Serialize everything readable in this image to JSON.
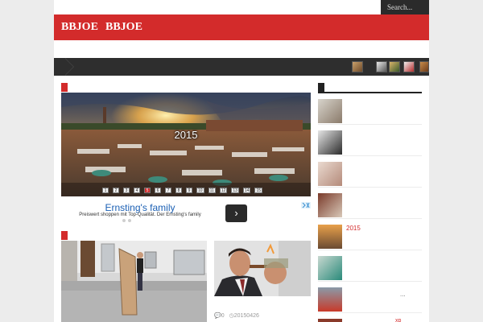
{
  "search": {
    "placeholder": "Search..."
  },
  "nav": {
    "items": [
      {
        "label": "BBJOE"
      },
      {
        "label": "BBJOE"
      }
    ]
  },
  "slider": {
    "title": "2015",
    "pages": [
      "1",
      "2",
      "3",
      "4",
      "5",
      "6",
      "7",
      "8",
      "9",
      "10",
      "11",
      "12",
      "13",
      "14",
      "15"
    ],
    "active_page": "5"
  },
  "ad": {
    "title": "Ernsting's family",
    "text": "Preiswert shoppen mit Top-Qualität. Der Ernsting's family",
    "arrow": "›"
  },
  "post_meta": {
    "comments": "0",
    "date": "20150426"
  },
  "sidebar": {
    "items": [
      {
        "label": ""
      },
      {
        "label": ""
      },
      {
        "label": ""
      },
      {
        "label": ""
      },
      {
        "label": "2015"
      },
      {
        "label": ""
      },
      {
        "label": "..."
      },
      {
        "label": "xp"
      }
    ]
  },
  "colors": {
    "brand_red": "#d32b2b",
    "dark_bar": "#2e2e2e",
    "link_blue": "#1a5fb4"
  }
}
